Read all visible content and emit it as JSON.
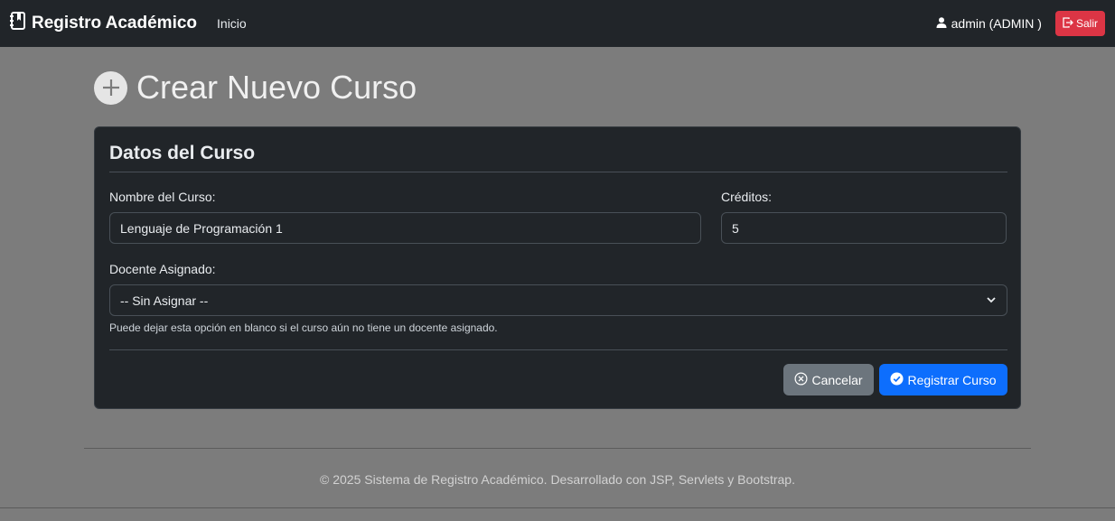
{
  "navbar": {
    "brand": "Registro Académico",
    "links": [
      {
        "label": "Inicio"
      }
    ],
    "user_label": "admin (ADMIN )",
    "logout_label": "Salir"
  },
  "page": {
    "title": "Crear Nuevo Curso"
  },
  "form": {
    "card_title": "Datos del Curso",
    "nombre_label": "Nombre del Curso:",
    "nombre_value": "Lenguaje de Programación 1",
    "creditos_label": "Créditos:",
    "creditos_value": "5",
    "docente_label": "Docente Asignado:",
    "docente_selected": "-- Sin Asignar --",
    "docente_help": "Puede dejar esta opción en blanco si el curso aún no tiene un docente asignado.",
    "cancel_label": "Cancelar",
    "submit_label": "Registrar Curso"
  },
  "footer": {
    "text": "© 2025 Sistema de Registro Académico. Desarrollado con JSP, Servlets y Bootstrap."
  },
  "icons": {
    "brand": "journal-bookmark-icon",
    "user": "person-icon",
    "logout": "box-arrow-right-icon",
    "title": "plus-circle-icon",
    "select": "chevron-down-icon",
    "cancel": "x-circle-icon",
    "submit": "check-circle-icon"
  },
  "colors": {
    "navbar_bg": "#212529",
    "page_bg": "#7c7c7c",
    "card_bg": "#212529",
    "danger": "#dc3545",
    "secondary": "#6c757d",
    "primary": "#0d6efd"
  }
}
